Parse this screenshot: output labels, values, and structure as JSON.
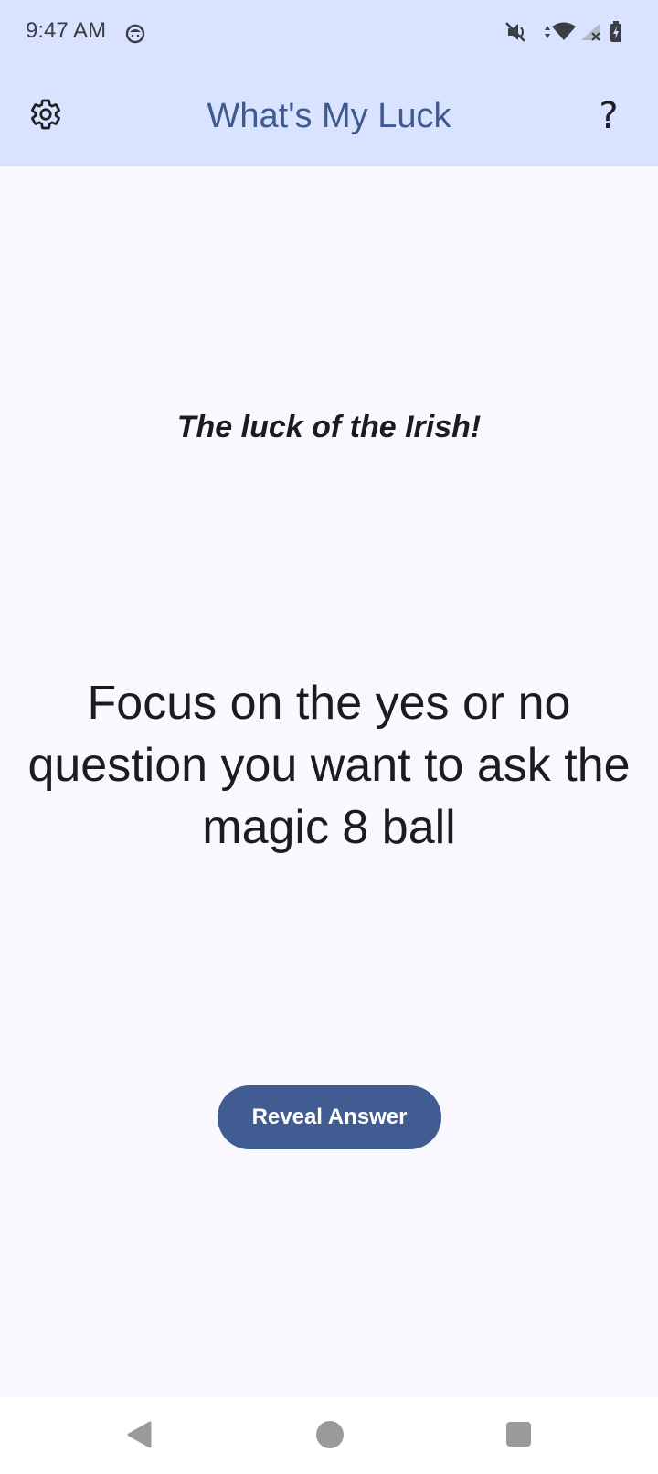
{
  "status_bar": {
    "time": "9:47 AM"
  },
  "app_bar": {
    "title": "What's My Luck",
    "settings_icon": "gear-icon",
    "help_label": "?"
  },
  "main": {
    "tagline": "The luck of the Irish!",
    "instruction": "Focus on the yes or no question you want to ask the magic 8 ball",
    "reveal_button_label": "Reveal Answer"
  },
  "colors": {
    "app_bar_background": "#d9e2ff",
    "title_color": "#3f5a91",
    "button_background": "#415c92",
    "page_background": "#f9f8ff"
  }
}
